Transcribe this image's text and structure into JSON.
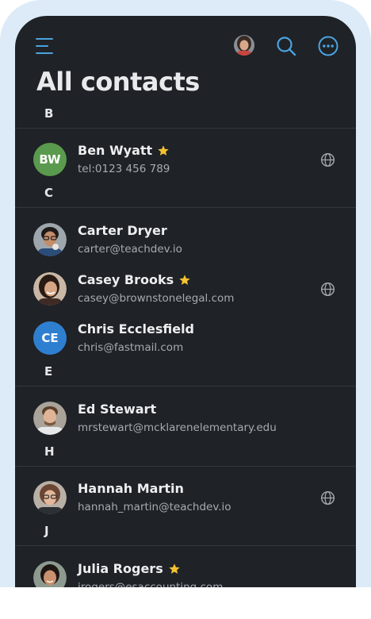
{
  "header": {
    "title": "All contacts",
    "icons": [
      "menu-icon",
      "user-avatar",
      "search-icon",
      "more-options-icon"
    ],
    "accent_color": "#4aa3e0"
  },
  "sections": [
    {
      "letter": "B"
    },
    {
      "letter": "C"
    },
    {
      "letter": "E"
    },
    {
      "letter": "H"
    },
    {
      "letter": "J"
    }
  ],
  "contacts": [
    {
      "name": "Ben Wyatt",
      "detail": "tel:0123 456 789",
      "initials": "BW",
      "avatar_color": "#5a9a4e",
      "favorite": true,
      "web_icon": true
    },
    {
      "name": "Carter Dryer",
      "detail": "carter@teachdev.io",
      "avatar": "photo",
      "favorite": false,
      "web_icon": false
    },
    {
      "name": "Casey Brooks",
      "detail": "casey@brownstonelegal.com",
      "avatar": "photo",
      "favorite": true,
      "web_icon": true
    },
    {
      "name": "Chris Ecclesfield",
      "detail": "chris@fastmail.com",
      "initials": "CE",
      "avatar_color": "#2f7fd1",
      "favorite": false,
      "web_icon": false
    },
    {
      "name": "Ed Stewart",
      "detail": "mrstewart@mcklarenelementary.edu",
      "avatar": "photo",
      "favorite": false,
      "web_icon": false
    },
    {
      "name": "Hannah Martin",
      "detail": "hannah_martin@teachdev.io",
      "avatar": "photo",
      "favorite": false,
      "web_icon": true
    },
    {
      "name": "Julia Rogers",
      "detail": "jrogers@esaccounting.com",
      "avatar": "photo",
      "favorite": true,
      "web_icon": false
    }
  ],
  "colors": {
    "background": "#1f2226",
    "frame": "#dcebf7",
    "star": "#f5c330",
    "divider": "#34383d"
  }
}
